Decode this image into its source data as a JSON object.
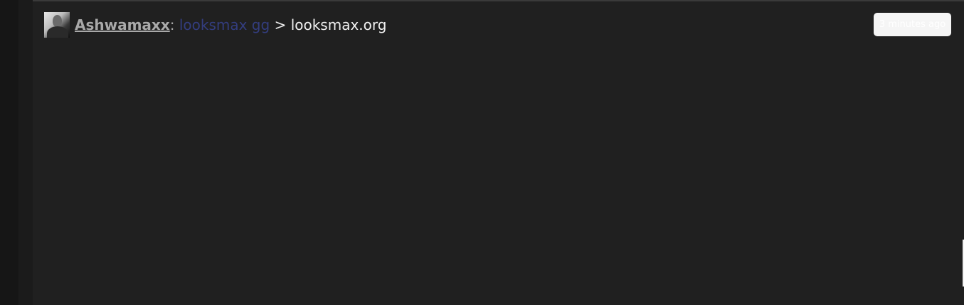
{
  "shout": {
    "username": "Ashwamaxx",
    "colon": ":",
    "link_text": "looksmax gg",
    "separator": ">",
    "message_text": "looksmax.org",
    "timestamp": "3 minutes ago"
  },
  "colors": {
    "background": "#202020",
    "username": "#a9a9a9",
    "link": "#333d7e",
    "timestamp_badge": "#f5f5f5"
  }
}
